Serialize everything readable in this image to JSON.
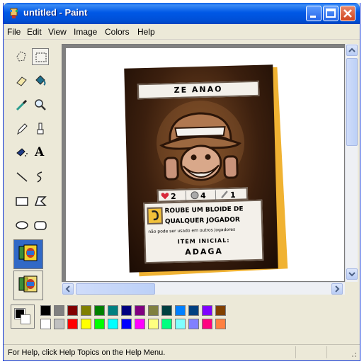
{
  "window": {
    "title": "untitled - Paint",
    "minimize_icon": "minimize-icon",
    "maximize_icon": "maximize-icon",
    "close_icon": "close-icon",
    "title_color": "#0058e6"
  },
  "menu": {
    "items": [
      "File",
      "Edit",
      "View",
      "Image",
      "Colors",
      "Help"
    ]
  },
  "tools": [
    {
      "name": "free-form-select",
      "icon": "free-form-select-icon"
    },
    {
      "name": "rectangle-select",
      "icon": "rectangle-select-icon",
      "selected": true
    },
    {
      "name": "eraser",
      "icon": "eraser-icon"
    },
    {
      "name": "fill",
      "icon": "fill-bucket-icon"
    },
    {
      "name": "pick-color",
      "icon": "eyedropper-icon"
    },
    {
      "name": "magnifier",
      "icon": "magnifier-icon"
    },
    {
      "name": "pencil",
      "icon": "pencil-icon"
    },
    {
      "name": "brush",
      "icon": "brush-icon"
    },
    {
      "name": "airbrush",
      "icon": "airbrush-icon"
    },
    {
      "name": "text",
      "icon": "text-icon",
      "glyph": "A"
    },
    {
      "name": "line",
      "icon": "line-icon"
    },
    {
      "name": "curve",
      "icon": "curve-icon"
    },
    {
      "name": "rectangle",
      "icon": "rectangle-icon"
    },
    {
      "name": "polygon",
      "icon": "polygon-icon"
    },
    {
      "name": "ellipse",
      "icon": "ellipse-icon"
    },
    {
      "name": "rounded-rectangle",
      "icon": "rounded-rectangle-icon"
    }
  ],
  "colors": {
    "foreground": "#000000",
    "background": "#ffffff",
    "row1": [
      "#000000",
      "#808080",
      "#800000",
      "#808000",
      "#008000",
      "#008080",
      "#000080",
      "#800080",
      "#808040",
      "#004040",
      "#0080ff",
      "#004080",
      "#8000ff",
      "#804000"
    ],
    "row2": [
      "#ffffff",
      "#c0c0c0",
      "#ff0000",
      "#ffff00",
      "#00ff00",
      "#00ffff",
      "#0000ff",
      "#ff00ff",
      "#ffff80",
      "#00ff80",
      "#80ffff",
      "#8080ff",
      "#ff0080",
      "#ff8040"
    ]
  },
  "card": {
    "name": "ZE ANAO",
    "stat_health": "2",
    "stat_coins": "4",
    "stat_attack": "1",
    "line1": "ROUBE UM BLOIDE DE",
    "line2": "QUALQUER JOGADOR",
    "line3": "não pode ser usado em outros jogadores",
    "line4": "ITEM INICIAL:",
    "line5": "ADAGA",
    "accent": "#f0b232"
  },
  "status": {
    "text": "For Help, click Help Topics on the Help Menu."
  }
}
